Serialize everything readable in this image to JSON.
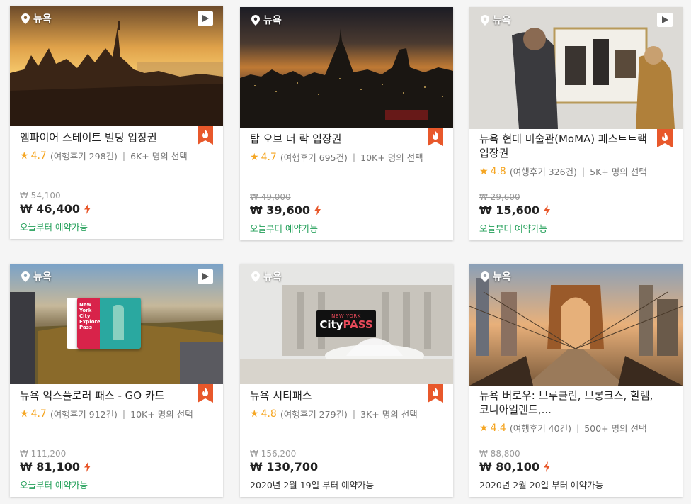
{
  "colors": {
    "accent": "#e8582b",
    "rating": "#f5a623",
    "available": "#24a05a"
  },
  "icons": {
    "location": "map-pin-icon",
    "video": "play-icon",
    "hot": "flame-badge-icon",
    "instant": "lightning-icon",
    "rating": "star-icon"
  },
  "cards": [
    {
      "location": "뉴욕",
      "title": "엠파이어 스테이트 빌딩 입장권",
      "score": "4.7",
      "reviews": "(여행후기 298건)",
      "chosen": "6K+ 명의 선택",
      "orig_price": "₩ 54,100",
      "price": "₩ 46,400",
      "availability": "오늘부터 예약가능"
    },
    {
      "location": "뉴욕",
      "title": "탑 오브 더 락 입장권",
      "score": "4.7",
      "reviews": "(여행후기 695건)",
      "chosen": "10K+ 명의 선택",
      "orig_price": "₩ 49,000",
      "price": "₩ 39,600",
      "availability": "오늘부터 예약가능"
    },
    {
      "location": "뉴욕",
      "title": "뉴욕 현대 미술관(MoMA) 패스트트랙 입장권",
      "score": "4.8",
      "reviews": "(여행후기 326건)",
      "chosen": "5K+ 명의 선택",
      "orig_price": "₩ 29,600",
      "price": "₩ 15,600",
      "availability": "오늘부터 예약가능"
    },
    {
      "location": "뉴욕",
      "title": "뉴욕 익스플로러 패스 - GO 카드",
      "score": "4.7",
      "reviews": "(여행후기 912건)",
      "chosen": "10K+ 명의 선택",
      "orig_price": "₩ 111,200",
      "price": "₩ 81,100",
      "availability": "오늘부터 예약가능",
      "card_text": [
        "New York City",
        "Explorer",
        "Pass"
      ]
    },
    {
      "location": "뉴욕",
      "title": "뉴욕 시티패스",
      "score": "4.8",
      "reviews": "(여행후기 279건)",
      "chosen": "3K+ 명의 선택",
      "orig_price": "₩ 156,200",
      "price": "₩ 130,700",
      "availability": "2020년 2월 19일 부터 예약가능",
      "logo_top": "NEW YORK",
      "logo_city": "City",
      "logo_pass": "PASS"
    },
    {
      "location": "뉴욕",
      "title": "뉴욕 버로우: 브루클린, 브롱크스, 할렘, 코니아일랜드,...",
      "score": "4.4",
      "reviews": "(여행후기 40건)",
      "chosen": "500+ 명의 선택",
      "orig_price": "₩ 88,800",
      "price": "₩ 80,100",
      "availability": "2020년 2월 20일 부터 예약가능"
    }
  ]
}
